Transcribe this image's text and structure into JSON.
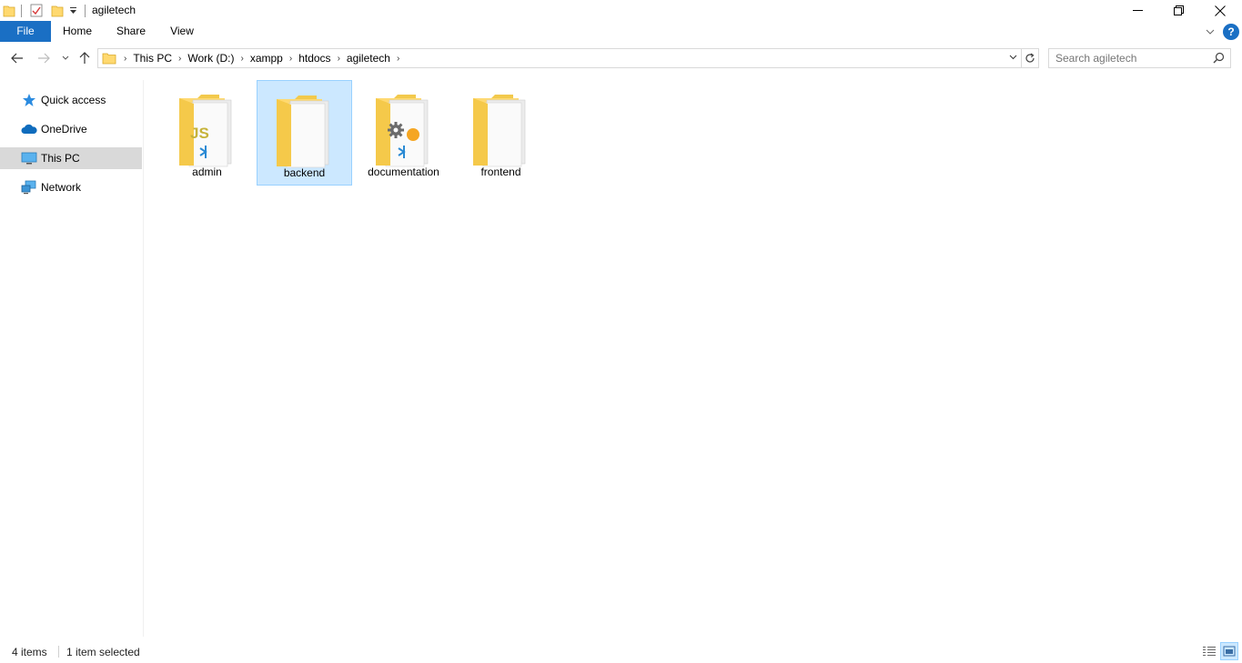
{
  "window": {
    "title": "agiletech",
    "minimize_symbol": "—",
    "maximize_symbol": "❐",
    "close_symbol": "✕"
  },
  "ribbon": {
    "tabs": [
      {
        "label": "File"
      },
      {
        "label": "Home"
      },
      {
        "label": "Share"
      },
      {
        "label": "View"
      }
    ],
    "expand_symbol": "⌄",
    "help_symbol": "?"
  },
  "address": {
    "breadcrumbs": [
      {
        "label": "This PC"
      },
      {
        "label": "Work (D:)"
      },
      {
        "label": "xampp"
      },
      {
        "label": "htdocs"
      },
      {
        "label": "agiletech"
      }
    ],
    "separator": "›"
  },
  "search": {
    "placeholder": "Search agiletech"
  },
  "sidebar": {
    "items": [
      {
        "label": "Quick access",
        "icon": "star-icon"
      },
      {
        "label": "OneDrive",
        "icon": "cloud-icon"
      },
      {
        "label": "This PC",
        "icon": "computer-icon",
        "selected": true
      },
      {
        "label": "Network",
        "icon": "network-icon"
      }
    ]
  },
  "folders": [
    {
      "name": "admin",
      "icon": "js-folder-icon",
      "selected": false
    },
    {
      "name": "backend",
      "icon": "folder-icon",
      "selected": true
    },
    {
      "name": "documentation",
      "icon": "settings-folder-icon",
      "selected": false
    },
    {
      "name": "frontend",
      "icon": "folder-icon",
      "selected": false
    }
  ],
  "status": {
    "item_count": "4 items",
    "selection": "1 item selected"
  },
  "colors": {
    "accent": "#1a6fc4",
    "selection_bg": "#cce8ff",
    "selection_border": "#99d1ff",
    "folder_yellow": "#ffd970"
  }
}
